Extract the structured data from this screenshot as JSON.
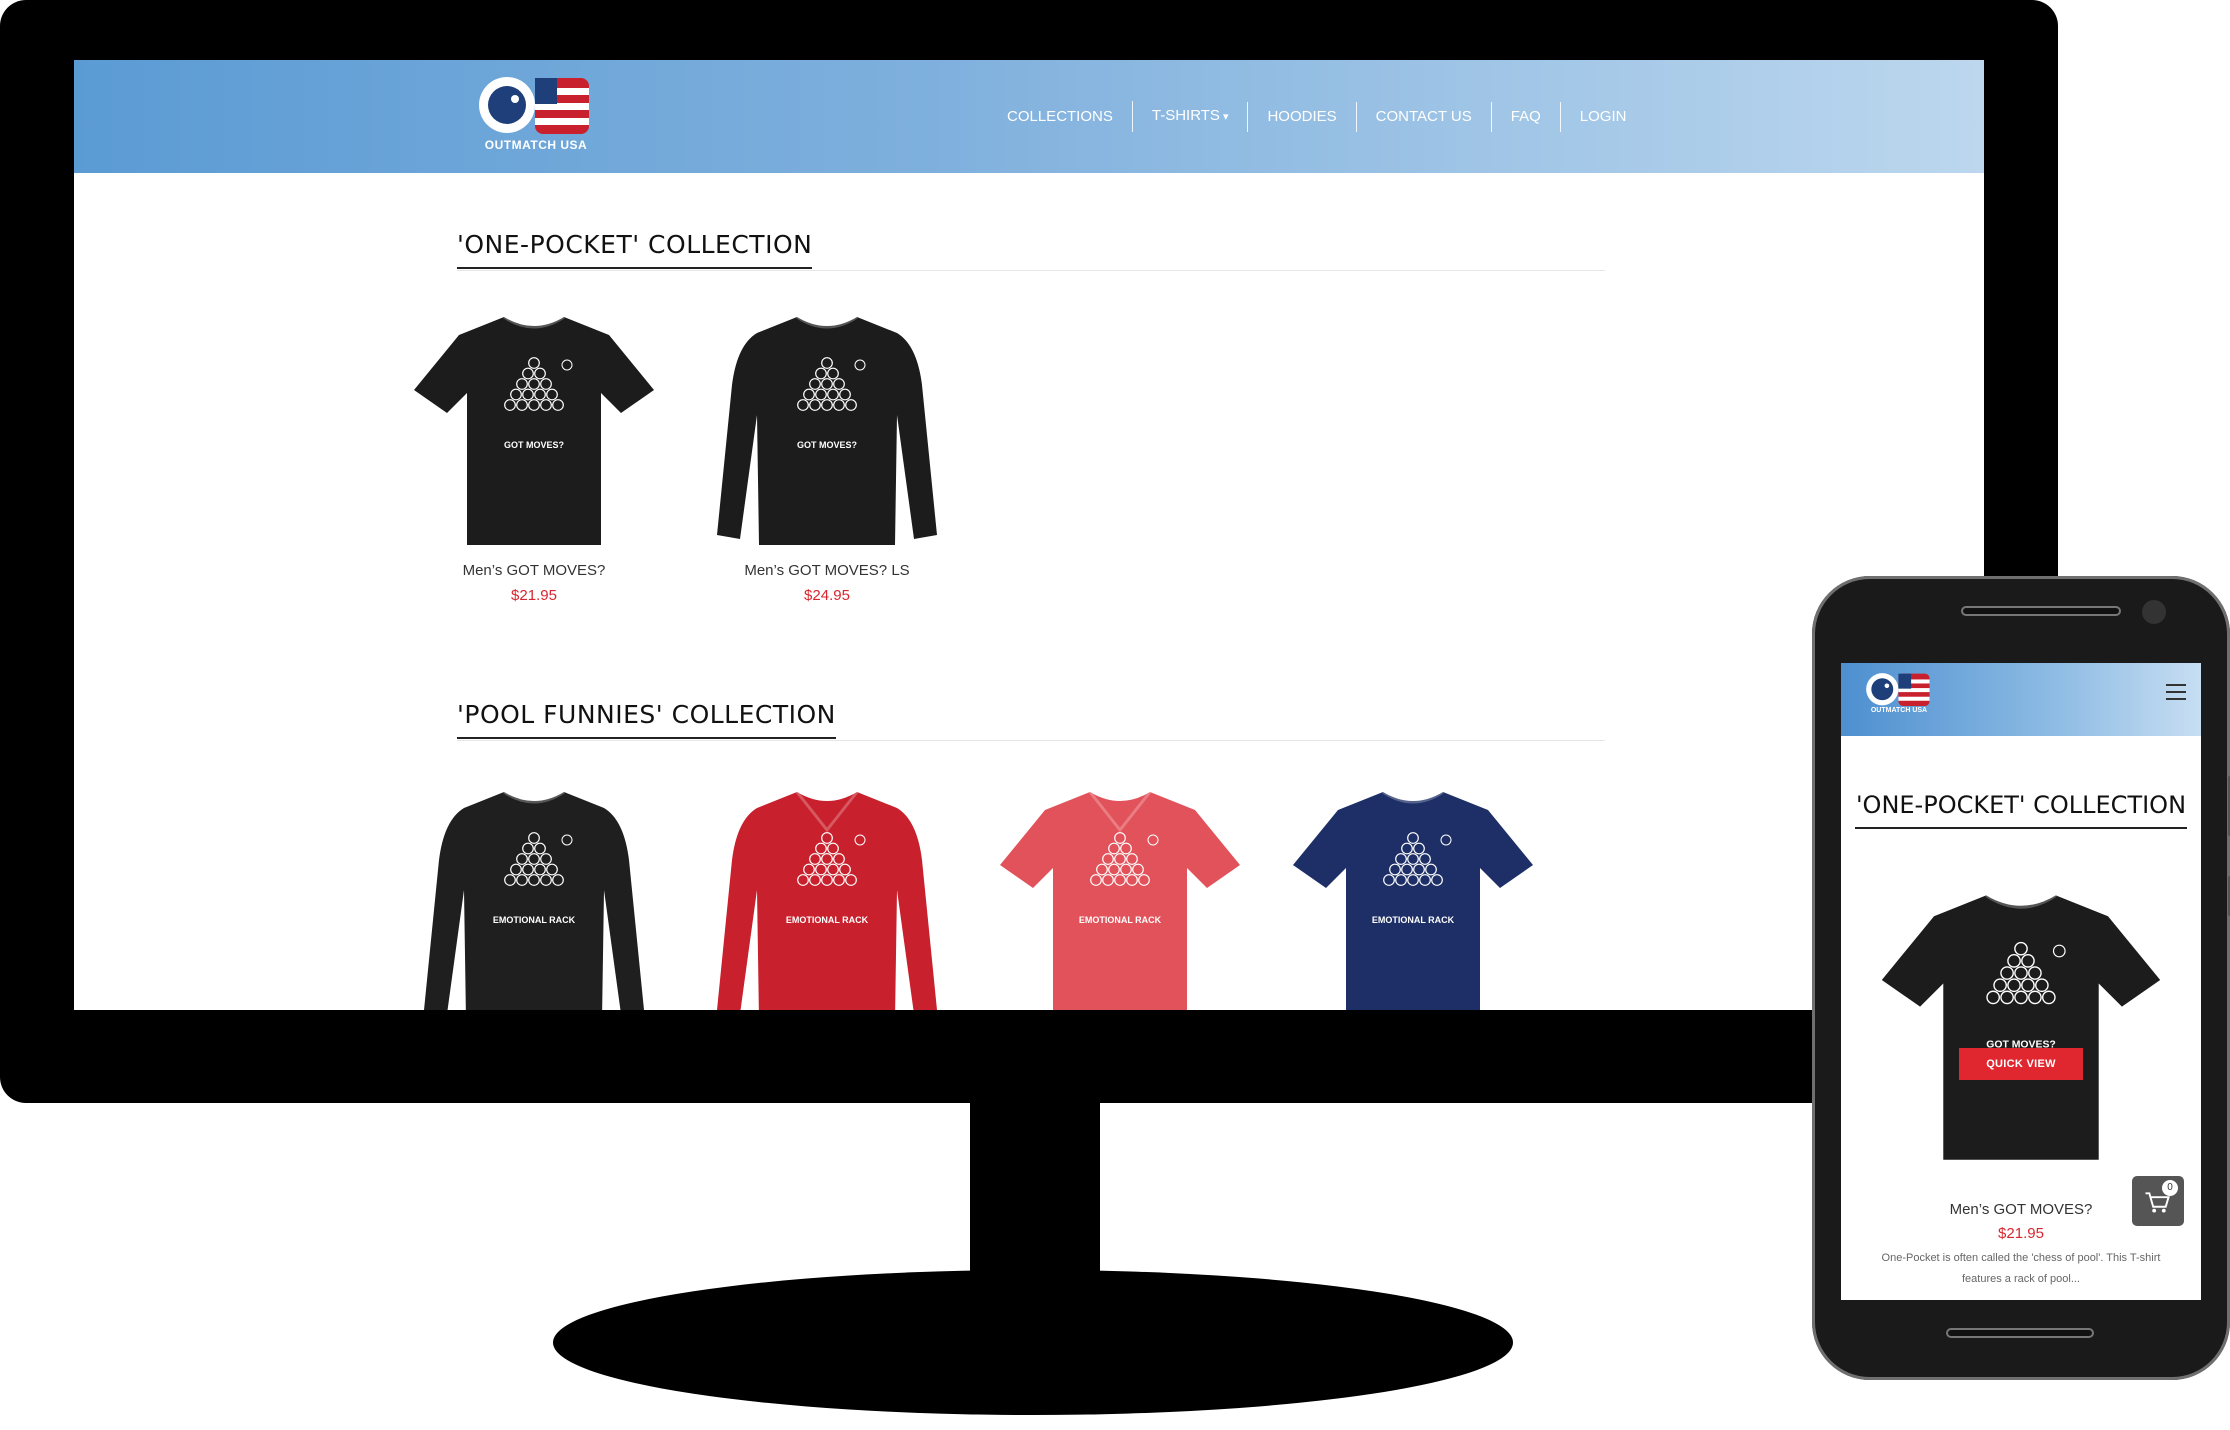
{
  "site": {
    "brand": "OUTMATCH USA",
    "nav": [
      {
        "label": "COLLECTIONS"
      },
      {
        "label": "T-SHIRTS",
        "has_dropdown": true
      },
      {
        "label": "HOODIES"
      },
      {
        "label": "CONTACT US"
      },
      {
        "label": "FAQ"
      },
      {
        "label": "LOGIN"
      }
    ],
    "cart_count": "0"
  },
  "collections": [
    {
      "title": "'ONE-POCKET' COLLECTION",
      "products": [
        {
          "name": "Men’s GOT MOVES?",
          "price": "$21.95",
          "shirt_text": "GOT MOVES?",
          "color": "#1c1c1c",
          "style": "tee"
        },
        {
          "name": "Men’s GOT MOVES? LS",
          "price": "$24.95",
          "shirt_text": "GOT MOVES?",
          "color": "#1c1c1c",
          "style": "longsleeve"
        }
      ]
    },
    {
      "title": "'POOL FUNNIES' COLLECTION",
      "products": [
        {
          "color": "#1f1f1f",
          "style": "longsleeve",
          "shirt_text": "EMOTIONAL RACK"
        },
        {
          "color": "#c8202c",
          "style": "longsleeve-v",
          "shirt_text": "EMOTIONAL RACK"
        },
        {
          "color": "#e2525a",
          "style": "tee-v",
          "shirt_text": "EMOTIONAL RACK"
        },
        {
          "color": "#1d2f66",
          "style": "tee",
          "shirt_text": "EMOTIONAL RACK"
        }
      ]
    }
  ],
  "mobile": {
    "title": "'ONE-POCKET' COLLECTION",
    "quick_view": "QUICK VIEW",
    "product_name": "Men’s GOT MOVES?",
    "product_price": "$21.95",
    "product_desc": "One-Pocket is often called the 'chess of pool'. This T-shirt features a rack of pool...",
    "shirt_text": "GOT MOVES?",
    "cart_count": "0"
  },
  "colors": {
    "accent_red": "#d7262f",
    "header_blue": "#5b9bd4"
  },
  "icons": [
    "cart-icon",
    "menu-icon",
    "chevron-down-icon"
  ]
}
